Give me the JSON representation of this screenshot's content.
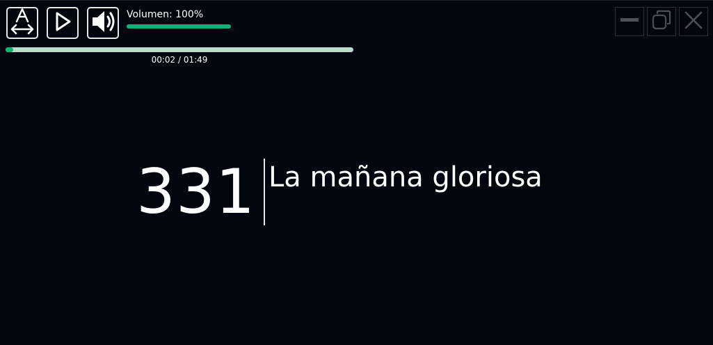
{
  "toolbar": {
    "font_button_icon": "font-size-icon",
    "play_button_icon": "play-icon",
    "volume_button_icon": "speaker-icon",
    "volume_label": "Volumen: 100%",
    "volume_level": 1.0
  },
  "playback": {
    "time_label": "00:02 / 01:49",
    "progress_fraction": 0.018
  },
  "window_controls": {
    "minimize_icon": "minimize-icon",
    "maximize_icon": "restore-icon",
    "close_icon": "close-icon"
  },
  "hymn": {
    "number": "331",
    "title": "La mañana gloriosa"
  },
  "colors": {
    "background": "#03060f",
    "accent": "#13b07a",
    "progress_track": "#b9dccb",
    "text": "#ffffff"
  }
}
